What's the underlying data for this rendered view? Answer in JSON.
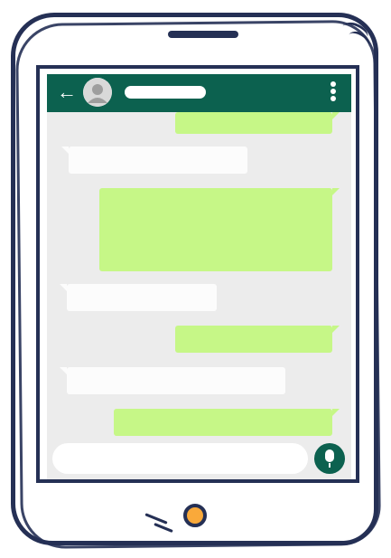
{
  "colors": {
    "frame": "#253055",
    "app_bar": "#0c614f",
    "chat_background": "#ececec",
    "outgoing_bubble": "#c6f787",
    "incoming_bubble": "#fcfcfc",
    "home_button": "#f9a93a"
  },
  "app_bar": {
    "back_icon": "arrow-left-icon",
    "avatar_icon": "default-avatar-icon",
    "contact_name": "",
    "menu_icon": "more-vert-icon"
  },
  "messages": [
    {
      "direction": "outgoing",
      "text": ""
    },
    {
      "direction": "incoming",
      "text": ""
    },
    {
      "direction": "outgoing",
      "text": ""
    },
    {
      "direction": "incoming",
      "text": ""
    },
    {
      "direction": "outgoing",
      "text": ""
    },
    {
      "direction": "incoming",
      "text": ""
    },
    {
      "direction": "outgoing",
      "text": ""
    }
  ],
  "input_bar": {
    "emoji_icon": "emoji-icon",
    "message_value": "",
    "camera_icon": "camera-icon",
    "mic_icon": "mic-icon"
  }
}
